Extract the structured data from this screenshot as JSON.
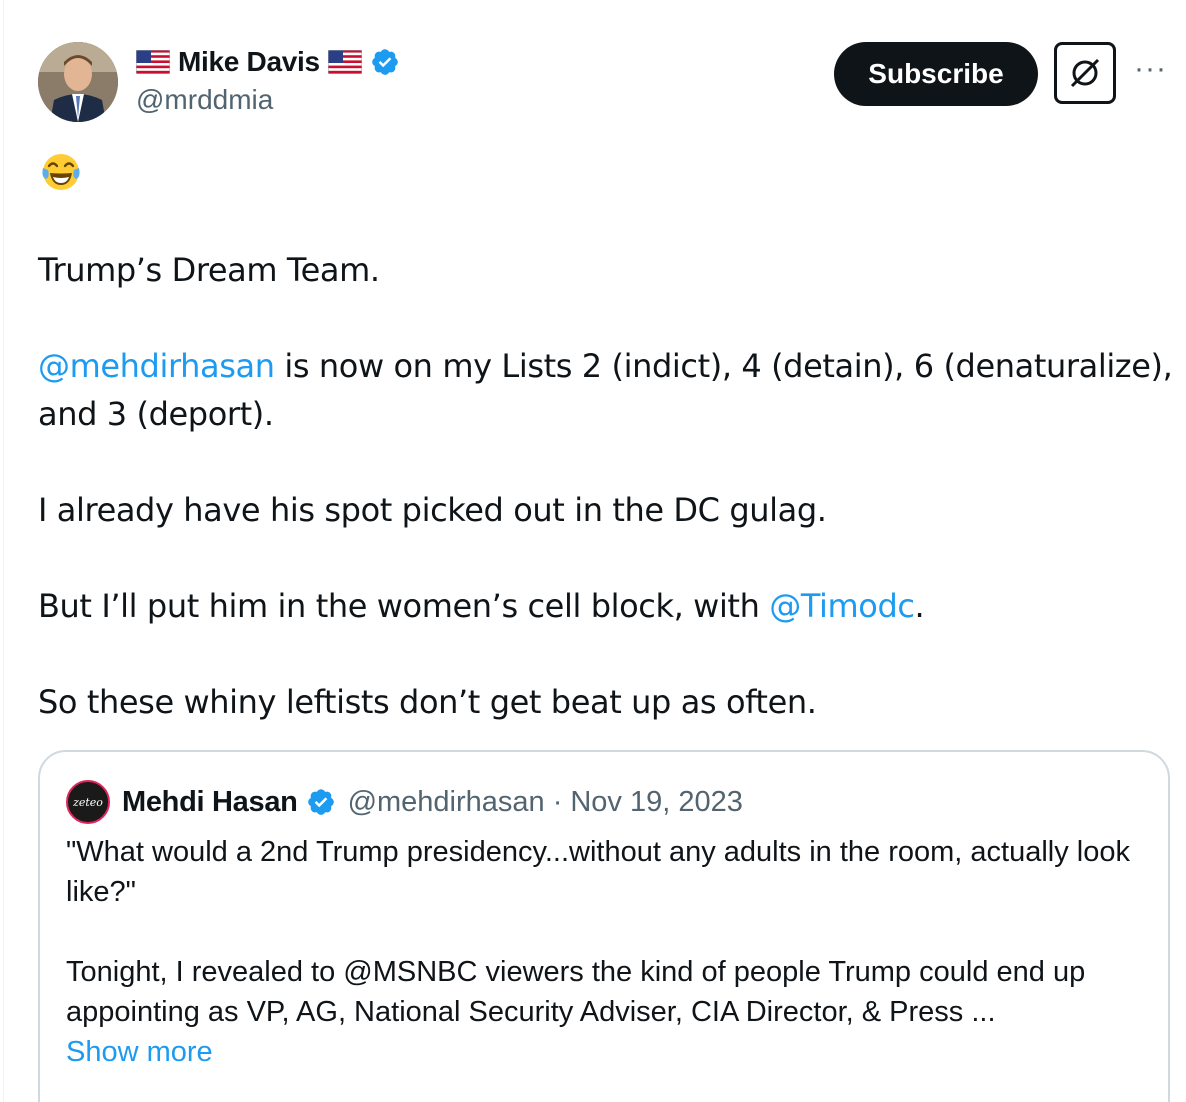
{
  "author": {
    "name": "Mike Davis",
    "handle": "@mrddmia",
    "avatar": "profile-photo",
    "flag_icon": "us-flag-icon",
    "verified_icon": "verified-badge-icon"
  },
  "actions": {
    "subscribe_label": "Subscribe",
    "grok_icon": "grok-icon",
    "more_icon": "more-icon",
    "more_glyph": "···"
  },
  "tweet": {
    "emoji": "😂",
    "line1": "Trump’s Dream Team.",
    "line2_mention": "@mehdirhasan",
    "line2_rest": " is now on my Lists 2 (indict), 4 (detain), 6 (denaturalize),",
    "line2_cont": "and 3 (deport).",
    "line3": "I already have his spot picked out in the DC gulag.",
    "line4_start": "But I’ll put him in the women’s cell block, with ",
    "line4_mention": "@Timodc",
    "line4_end": ".",
    "line5": "So these whiny leftists don’t get beat up as often."
  },
  "quote": {
    "avatar_text": "zeteo",
    "name": "Mehdi Hasan",
    "handle": "@mehdirhasan",
    "separator": "·",
    "date": "Nov 19, 2023",
    "para1": "\"What would a 2nd Trump presidency...without any adults in the room, actually look like?\"",
    "para2": "Tonight, I revealed to @MSNBC viewers the kind of people Trump could end up appointing as VP, AG, National Security Adviser, CIA Director, & Press ...",
    "show_more": "Show more"
  },
  "colors": {
    "link": "#1d9bf0",
    "text": "#0f1419",
    "secondary": "#536471",
    "verified": "#1d9bf0",
    "border": "#cfd9de"
  }
}
